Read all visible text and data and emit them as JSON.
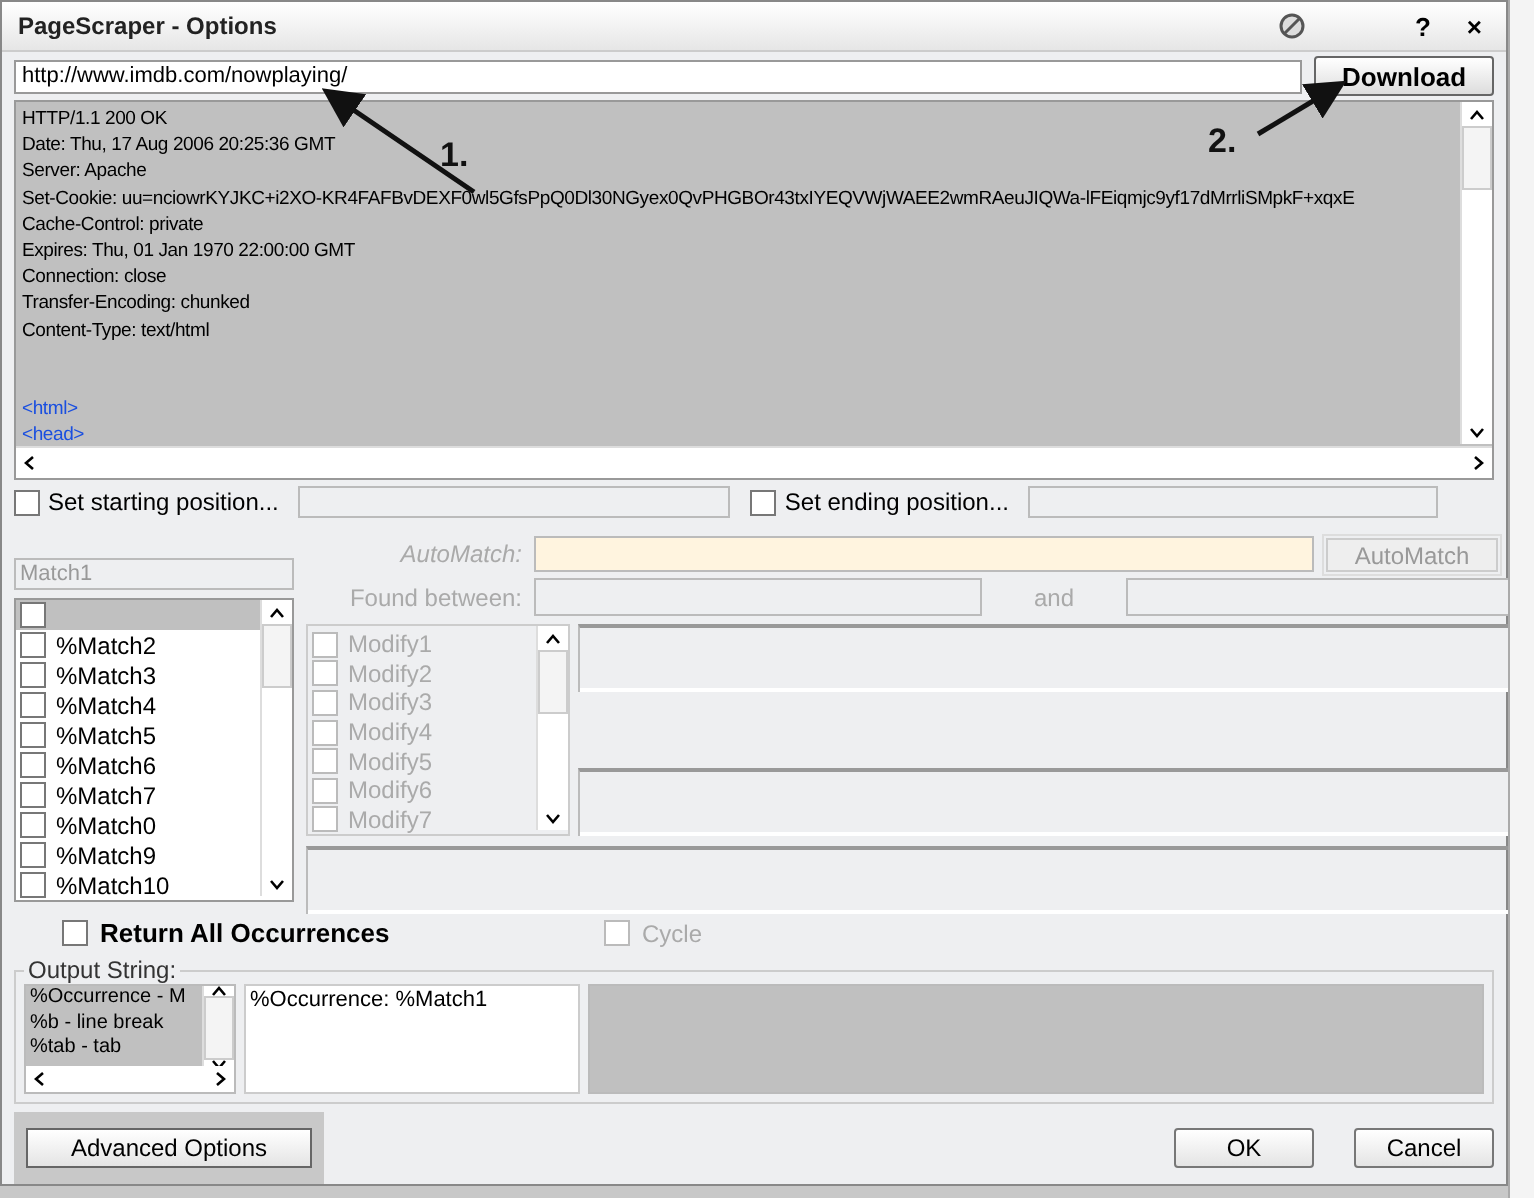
{
  "window": {
    "title": "PageScraper - Options",
    "title_buttons": [
      "?",
      "×"
    ]
  },
  "url_field": {
    "value": "http://www.imdb.com/nowplaying/"
  },
  "download_button": "Download",
  "annotations": [
    {
      "label": "1."
    },
    {
      "label": "2."
    }
  ],
  "response_lines": [
    {
      "kind": "header",
      "text": "HTTP/1.1 200 OK"
    },
    {
      "kind": "header",
      "text": "Date: Thu, 17 Aug 2006 20:25:36 GMT"
    },
    {
      "kind": "header",
      "text": "Server: Apache"
    },
    {
      "kind": "header",
      "text": "Set-Cookie: uu=nciowrKYJKC+i2XO-KR4FAFBvDEXF0wl5GfsPpQ0Dl30NGyex0QvPHGBOr43txIYEQVWjWAEE2wmRAeuJIQWa-lFEiqmjc9yf17dMrrliSMpkF+xqxE"
    },
    {
      "kind": "header",
      "text": "Cache-Control: private"
    },
    {
      "kind": "header",
      "text": "Expires: Thu, 01 Jan 1970 22:00:00 GMT"
    },
    {
      "kind": "header",
      "text": "Connection: close"
    },
    {
      "kind": "header",
      "text": "Transfer-Encoding: chunked"
    },
    {
      "kind": "header",
      "text": "Content-Type: text/html"
    },
    {
      "kind": "blank"
    },
    {
      "kind": "blank"
    },
    {
      "kind": "markup",
      "text": "<html>"
    },
    {
      "kind": "markup",
      "text": "<head>"
    }
  ],
  "start_position": {
    "label": "Set starting position...",
    "checked": false
  },
  "end_position": {
    "label": "Set ending position...",
    "checked": false
  },
  "match_name": {
    "placeholder": "Match1"
  },
  "matches": [
    {
      "checked": false,
      "selected": true
    },
    {
      "label": "%Match2",
      "checked": false,
      "selected": false
    },
    {
      "label": "%Match3",
      "checked": false,
      "selected": false
    },
    {
      "label": "%Match4",
      "checked": false,
      "selected": false
    },
    {
      "label": "%Match5",
      "checked": false,
      "selected": false
    },
    {
      "label": "%Match6",
      "checked": false,
      "selected": false
    },
    {
      "label": "%Match7",
      "checked": false,
      "selected": false
    },
    {
      "label": "%Match0",
      "checked": false,
      "selected": false
    },
    {
      "label": "%Match9",
      "checked": false,
      "selected": false
    },
    {
      "label": "%Match10",
      "checked": false,
      "selected": false
    }
  ],
  "automatch": {
    "label": "AutoMatch:",
    "button": "AutoMatch"
  },
  "found_between": {
    "label": "Found between:",
    "and_label": "and"
  },
  "modifiers": [
    {
      "label": "Modify1",
      "checked": false
    },
    {
      "label": "Modify2",
      "checked": false
    },
    {
      "label": "Modify3",
      "checked": false
    },
    {
      "label": "Modify4",
      "checked": false
    },
    {
      "label": "Modify5",
      "checked": false
    },
    {
      "label": "Modify6",
      "checked": false
    },
    {
      "label": "Modify7",
      "checked": false
    }
  ],
  "return_all": {
    "label": "Return All Occurrences",
    "checked": false
  },
  "cycle": {
    "label": "Cycle",
    "checked": false,
    "disabled": true
  },
  "output_string": {
    "legend": "Output String:",
    "tokens": [
      "%Occurrence - M",
      "%b - line break",
      "%tab - tab"
    ],
    "value": "%Occurrence: %Match1"
  },
  "buttons": {
    "advanced": "Advanced Options",
    "ok": "OK",
    "cancel": "Cancel"
  }
}
